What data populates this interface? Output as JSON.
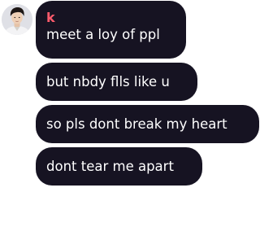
{
  "chat": {
    "sender_name": "k",
    "messages": [
      {
        "text": "meet a loy of ppl"
      },
      {
        "text": "but nbdy flls like u"
      },
      {
        "text": "so pls dont break my heart"
      },
      {
        "text": "dont tear me apart"
      }
    ],
    "avatar": {
      "icon": "avatar-photo",
      "alt": "profile photo"
    },
    "colors": {
      "bubble_bg": "#161322",
      "bubble_text": "#ffffff",
      "sender_name": "#ff5b6c",
      "page_bg": "#ffffff"
    }
  }
}
